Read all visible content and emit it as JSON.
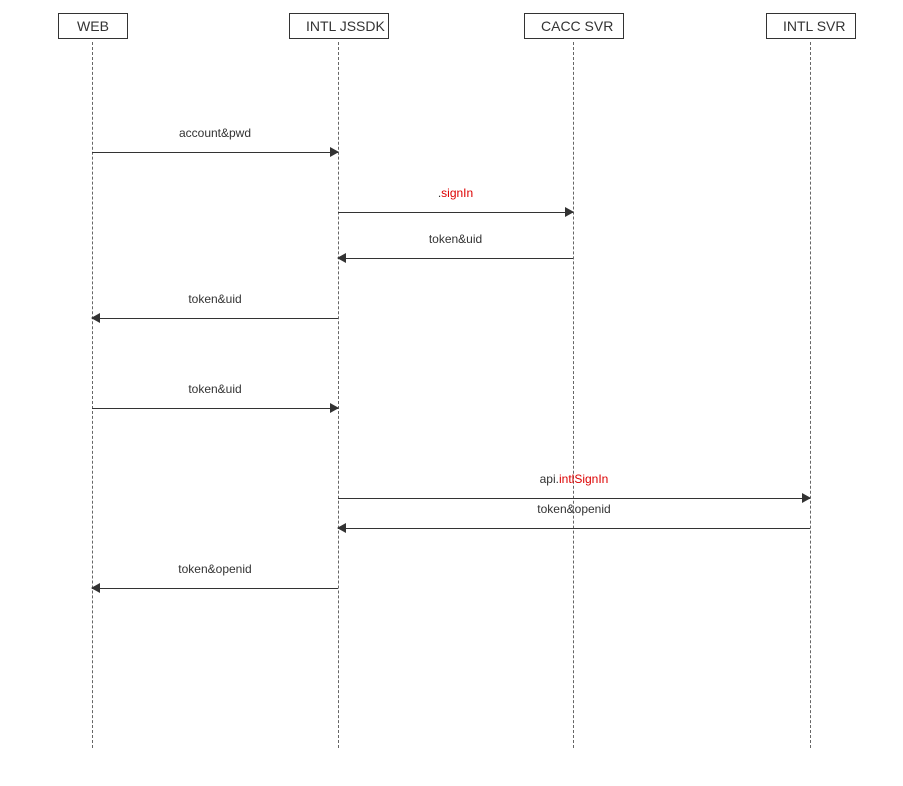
{
  "participants": {
    "web": "WEB",
    "jssdk": "INTL JSSDK",
    "cacc": "CACC SVR",
    "intl": "INTL SVR"
  },
  "messages": {
    "m1": "account&pwd",
    "m2_prefix": ".",
    "m2_hl": "signIn",
    "m3": "token&uid",
    "m4": "token&uid",
    "m5": "token&uid",
    "m6_prefix": "api.",
    "m6_hl": "intlSignIn",
    "m7": "token&openid",
    "m8": "token&openid"
  },
  "chart_data": {
    "type": "sequence-diagram",
    "participants": [
      "WEB",
      "INTL JSSDK",
      "CACC SVR",
      "INTL SVR"
    ],
    "messages": [
      {
        "from": "WEB",
        "to": "INTL JSSDK",
        "label": "account&pwd",
        "highlight": false
      },
      {
        "from": "INTL JSSDK",
        "to": "CACC SVR",
        "label": ".signIn",
        "highlight": true
      },
      {
        "from": "CACC SVR",
        "to": "INTL JSSDK",
        "label": "token&uid",
        "highlight": false
      },
      {
        "from": "INTL JSSDK",
        "to": "WEB",
        "label": "token&uid",
        "highlight": false
      },
      {
        "from": "WEB",
        "to": "INTL JSSDK",
        "label": "token&uid",
        "highlight": false
      },
      {
        "from": "INTL JSSDK",
        "to": "INTL SVR",
        "label": "api.intlSignIn",
        "highlight": true
      },
      {
        "from": "INTL SVR",
        "to": "INTL JSSDK",
        "label": "token&openid",
        "highlight": false
      },
      {
        "from": "INTL JSSDK",
        "to": "WEB",
        "label": "token&openid",
        "highlight": false
      }
    ]
  }
}
